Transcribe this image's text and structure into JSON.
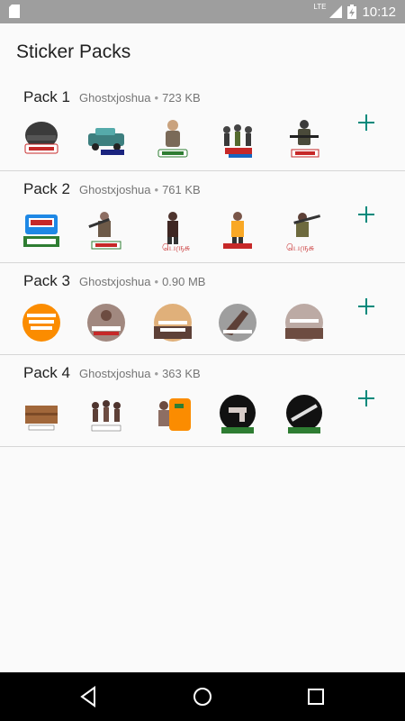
{
  "status_bar": {
    "time": "10:12",
    "network": "LTE"
  },
  "app_bar": {
    "title": "Sticker Packs"
  },
  "packs": [
    {
      "name": "Pack 1",
      "author": "Ghostxjoshua",
      "separator": "•",
      "size": "723 KB",
      "stickers": [
        "helmet-sticker",
        "car-sticker",
        "character-sticker",
        "squad-sticker",
        "soldier-sticker"
      ]
    },
    {
      "name": "Pack 2",
      "author": "Ghostxjoshua",
      "separator": "•",
      "size": "761 KB",
      "stickers": [
        "awm-crate-sticker",
        "gunner-sticker",
        "female-character-sticker",
        "yellow-character-sticker",
        "rifle-character-sticker"
      ]
    },
    {
      "name": "Pack 3",
      "author": "Ghostxjoshua",
      "separator": "•",
      "size": "0.90 MB",
      "stickers": [
        "orange-badge-sticker",
        "round-character-sticker",
        "sunset-sticker",
        "hand-sticker",
        "field-sticker"
      ]
    },
    {
      "name": "Pack 4",
      "author": "Ghostxjoshua",
      "separator": "•",
      "size": "363 KB",
      "stickers": [
        "crate-sticker",
        "group-sticker",
        "orange-character-sticker",
        "pistol-sticker",
        "rifle-sticker"
      ]
    }
  ],
  "colors": {
    "accent": "#00897b",
    "status_bar": "#9e9e9e",
    "nav_bar": "#000000"
  }
}
